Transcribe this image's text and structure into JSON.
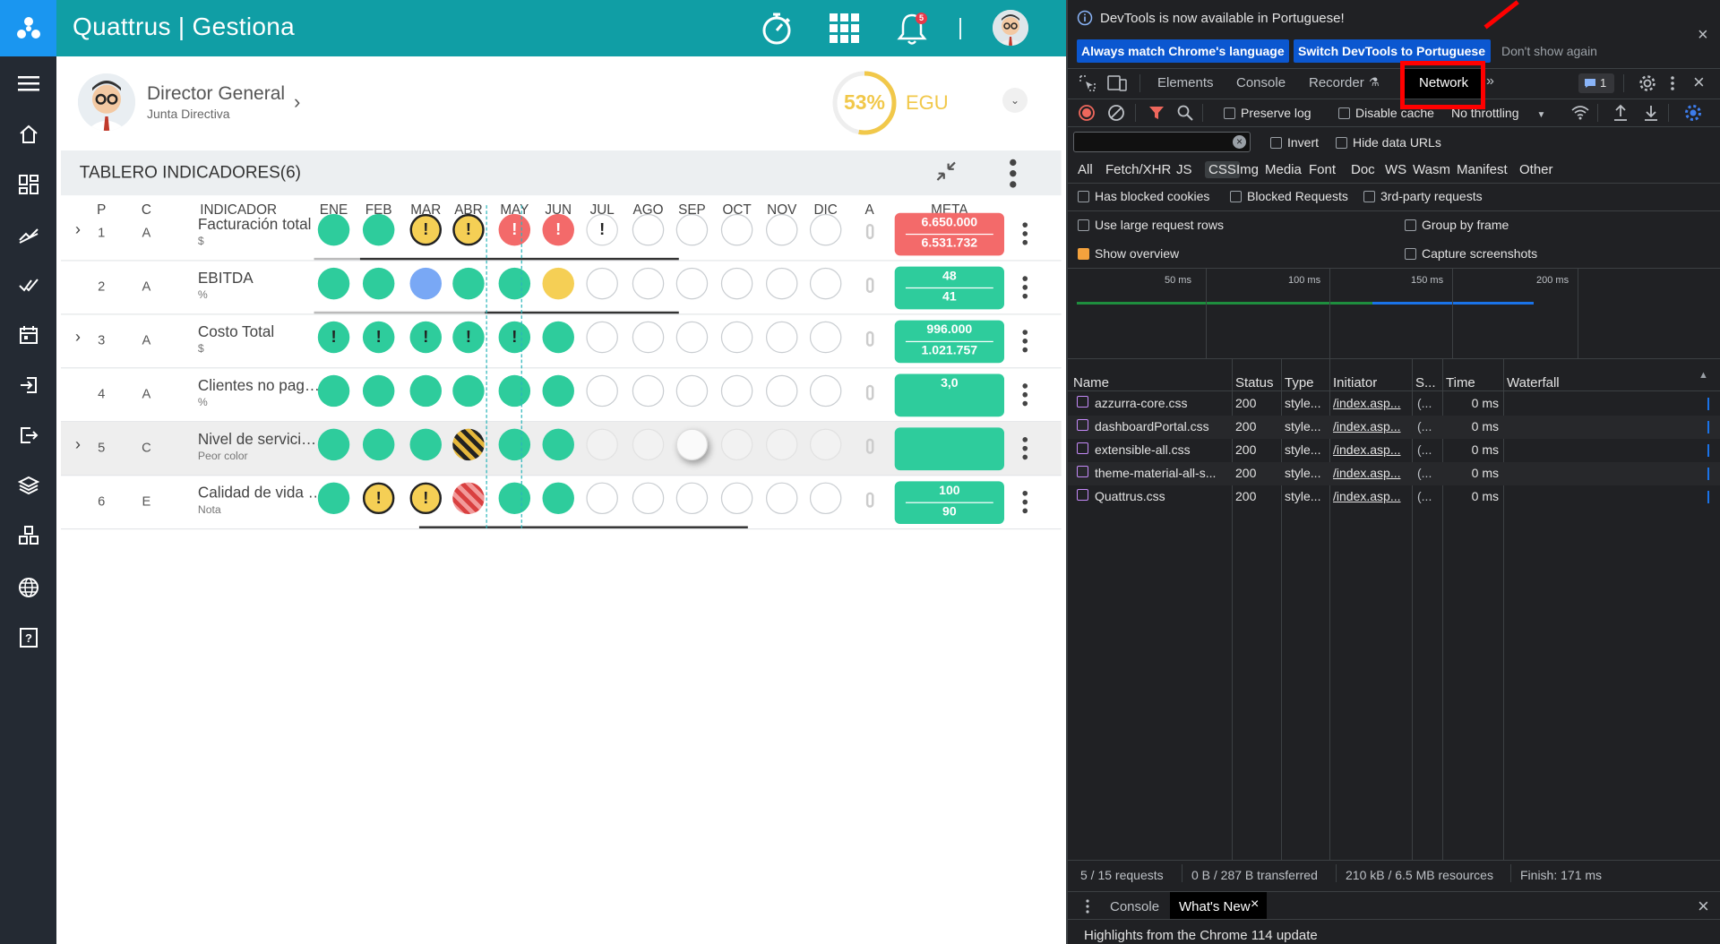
{
  "app": {
    "title": "Quattrus | Gestiona",
    "notification_count": "5",
    "rail_icons": [
      "menu-icon",
      "home-icon",
      "dashboard-icon",
      "trend-icon",
      "check-icon",
      "calendar-icon",
      "login-icon",
      "logout-icon",
      "layers-icon",
      "widgets-icon",
      "globe-icon",
      "help-icon"
    ]
  },
  "profile": {
    "name": "Director General",
    "role": "Junta Directiva",
    "gauge_value": "53%",
    "gauge_fraction": 0.53,
    "gauge_label": "EGU"
  },
  "board": {
    "title": "TABLERO INDICADORES(6)",
    "columns": {
      "p": "P",
      "c": "C",
      "indicador": "INDICADOR",
      "a": "A",
      "meta": "META"
    },
    "months": [
      "ENE",
      "FEB",
      "MAR",
      "ABR",
      "MAY",
      "JUN",
      "JUL",
      "AGO",
      "SEP",
      "OCT",
      "NOV",
      "DIC"
    ],
    "rows": [
      {
        "p": "1",
        "c": "A",
        "name": "Facturación total",
        "unit": "$",
        "expand": true,
        "highlight": false,
        "cells": [
          "g",
          "g",
          "y!",
          "y!",
          "r!",
          "r!",
          "w!",
          "e",
          "e",
          "e",
          "e",
          "e"
        ],
        "meta_top": "6.650.000",
        "meta_bottom": "6.531.732",
        "meta_color": "#f36a6a"
      },
      {
        "p": "2",
        "c": "A",
        "name": "EBITDA",
        "unit": "%",
        "expand": false,
        "highlight": false,
        "cells": [
          "g",
          "g",
          "b",
          "g",
          "g",
          "ys",
          "e",
          "e",
          "e",
          "e",
          "e",
          "e"
        ],
        "meta_top": "48",
        "meta_bottom": "41",
        "meta_color": "#2ecc9c"
      },
      {
        "p": "3",
        "c": "A",
        "name": "Costo Total",
        "unit": "$",
        "expand": true,
        "highlight": false,
        "cells": [
          "g!",
          "g!",
          "g!",
          "g!",
          "g!",
          "g",
          "e",
          "e",
          "e",
          "e",
          "e",
          "e"
        ],
        "meta_top": "996.000",
        "meta_bottom": "1.021.757",
        "meta_color": "#2ecc9c"
      },
      {
        "p": "4",
        "c": "A",
        "name": "Clientes no pagados",
        "unit": "%",
        "expand": false,
        "highlight": false,
        "cells": [
          "g",
          "g",
          "g",
          "g",
          "g",
          "g",
          "e",
          "e",
          "e",
          "e",
          "e",
          "e"
        ],
        "meta_top": "3,0",
        "meta_bottom": "",
        "meta_color": "#2ecc9c"
      },
      {
        "p": "5",
        "c": "C",
        "name": "Nivel de servicio al cliente",
        "unit": "Peor color",
        "expand": true,
        "highlight": true,
        "cells": [
          "g",
          "g",
          "g",
          "yst",
          "g",
          "g",
          "f",
          "f",
          "sh",
          "f",
          "f",
          "f"
        ],
        "meta_top": "",
        "meta_bottom": "",
        "meta_color": "#2ecc9c"
      },
      {
        "p": "6",
        "c": "E",
        "name": "Calidad de vida laboral",
        "unit": "Nota",
        "expand": false,
        "highlight": false,
        "cells": [
          "g",
          "y!",
          "y!",
          "rst",
          "g",
          "g",
          "e",
          "e",
          "e",
          "e",
          "e",
          "e"
        ],
        "meta_top": "100",
        "meta_bottom": "90",
        "meta_color": "#2ecc9c"
      }
    ]
  },
  "devtools": {
    "banner": "DevTools is now available in Portuguese!",
    "btn_match": "Always match Chrome's language",
    "btn_switch": "Switch DevTools to Portuguese",
    "btn_dont": "Don't show again",
    "tabs": [
      "Elements",
      "Console",
      "Recorder",
      "Network"
    ],
    "issues_count": "1",
    "preserve_log": "Preserve log",
    "disable_cache": "Disable cache",
    "throttling": "No throttling",
    "invert": "Invert",
    "hide_data_urls": "Hide data URLs",
    "filters": [
      "All",
      "Fetch/XHR",
      "JS",
      "CSS",
      "Img",
      "Media",
      "Font",
      "Doc",
      "WS",
      "Wasm",
      "Manifest",
      "Other"
    ],
    "active_filter": "CSS",
    "blocked_cookies": "Has blocked cookies",
    "blocked_requests": "Blocked Requests",
    "third_party": "3rd-party requests",
    "large_rows": "Use large request rows",
    "group_by_frame": "Group by frame",
    "show_overview": "Show overview",
    "capture_screenshots": "Capture screenshots",
    "timeline": [
      "50 ms",
      "100 ms",
      "150 ms",
      "200 ms"
    ],
    "table_headers": [
      "Name",
      "Status",
      "Type",
      "Initiator",
      "S...",
      "Time",
      "Waterfall"
    ],
    "requests": [
      {
        "name": "azzurra-core.css",
        "status": "200",
        "type": "style...",
        "initiator": "/index.asp...",
        "size": "(...",
        "time": "0 ms"
      },
      {
        "name": "dashboardPortal.css",
        "status": "200",
        "type": "style...",
        "initiator": "/index.asp...",
        "size": "(...",
        "time": "0 ms"
      },
      {
        "name": "extensible-all.css",
        "status": "200",
        "type": "style...",
        "initiator": "/index.asp...",
        "size": "(...",
        "time": "0 ms"
      },
      {
        "name": "theme-material-all-s...",
        "status": "200",
        "type": "style...",
        "initiator": "/index.asp...",
        "size": "(...",
        "time": "0 ms"
      },
      {
        "name": "Quattrus.css",
        "status": "200",
        "type": "style...",
        "initiator": "/index.asp...",
        "size": "(...",
        "time": "0 ms"
      }
    ],
    "status_requests": "5 / 15 requests",
    "status_transferred": "0 B / 287 B transferred",
    "status_resources": "210 kB / 6.5 MB resources",
    "status_finish": "Finish: 171 ms",
    "drawer_console": "Console",
    "drawer_whatsnew": "What's New",
    "drawer_text": "Highlights from the Chrome 114 update"
  }
}
